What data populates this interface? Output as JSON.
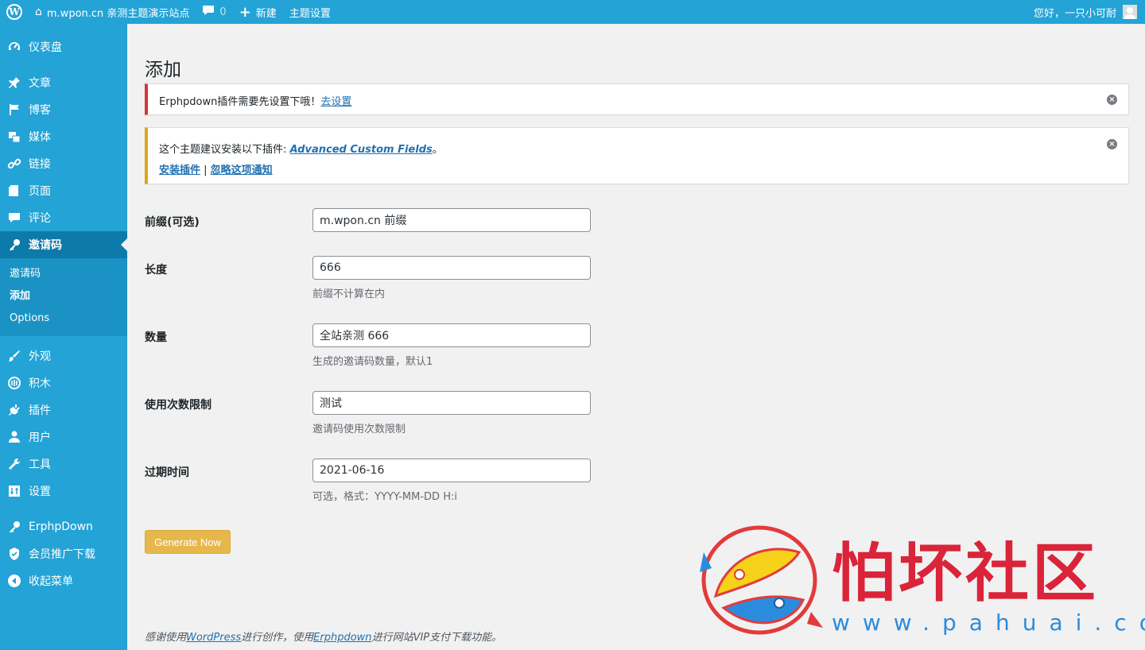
{
  "adminbar": {
    "site_name": "m.wpon.cn 亲测主题演示站点",
    "comments_count": "0",
    "new_label": "新建",
    "theme_settings": "主题设置",
    "greeting": "您好，一只小可耐"
  },
  "sidebar": {
    "items": [
      {
        "label": "仪表盘",
        "icon": "dashboard-icon"
      },
      {
        "label": "文章",
        "icon": "pin-icon"
      },
      {
        "label": "博客",
        "icon": "flag-icon"
      },
      {
        "label": "媒体",
        "icon": "media-icon"
      },
      {
        "label": "链接",
        "icon": "link-icon"
      },
      {
        "label": "页面",
        "icon": "page-icon"
      },
      {
        "label": "评论",
        "icon": "comment-icon"
      },
      {
        "label": "邀请码",
        "icon": "key-icon"
      },
      {
        "label": "外观",
        "icon": "brush-icon"
      },
      {
        "label": "积木",
        "icon": "blocks-icon"
      },
      {
        "label": "插件",
        "icon": "plugin-icon"
      },
      {
        "label": "用户",
        "icon": "user-icon"
      },
      {
        "label": "工具",
        "icon": "wrench-icon"
      },
      {
        "label": "设置",
        "icon": "settings-icon"
      },
      {
        "label": "ErphpDown",
        "icon": "key-icon"
      },
      {
        "label": "会员推广下载",
        "icon": "shield-icon"
      },
      {
        "label": "收起菜单",
        "icon": "collapse-icon"
      }
    ],
    "submenu": [
      {
        "label": "邀请码"
      },
      {
        "label": "添加"
      },
      {
        "label": "Options"
      }
    ]
  },
  "page": {
    "title": "添加",
    "notice_error": {
      "text": "Erphpdown插件需要先设置下哦！",
      "link": "去设置"
    },
    "notice_warning": {
      "text": "这个主题建议安装以下插件: ",
      "plugin": "Advanced Custom Fields",
      "period": "。",
      "install": "安装插件",
      "sep": " | ",
      "dismiss": "忽略这项通知"
    },
    "form": {
      "prefix_label": "前缀(可选)",
      "prefix_value": "m.wpon.cn 前缀",
      "length_label": "长度",
      "length_value": "666",
      "length_desc": "前缀不计算在内",
      "quantity_label": "数量",
      "quantity_value": "全站亲测 666",
      "quantity_desc": "生成的邀请码数量，默认1",
      "uses_label": "使用次数限制",
      "uses_value": "测试",
      "uses_desc": "邀请码使用次数限制",
      "expire_label": "过期时间",
      "expire_value": "2021-06-16",
      "expire_desc": "可选，格式：YYYY-MM-DD H:i",
      "submit": "Generate Now"
    },
    "footer": {
      "pre": "感谢使用",
      "wp": "WordPress",
      "mid": "进行创作，使用",
      "erphp": "Erphpdown",
      "post": "进行网站VIP支付下载功能。"
    }
  },
  "watermark": {
    "title": "怕坏社区",
    "url": "www.pahuai.com"
  },
  "colors": {
    "adminbar_bg": "#23a3d6",
    "menu_current": "#0e7aa9",
    "button": "#e6b84c",
    "notice_error": "#d63638",
    "notice_warning": "#dba617"
  }
}
